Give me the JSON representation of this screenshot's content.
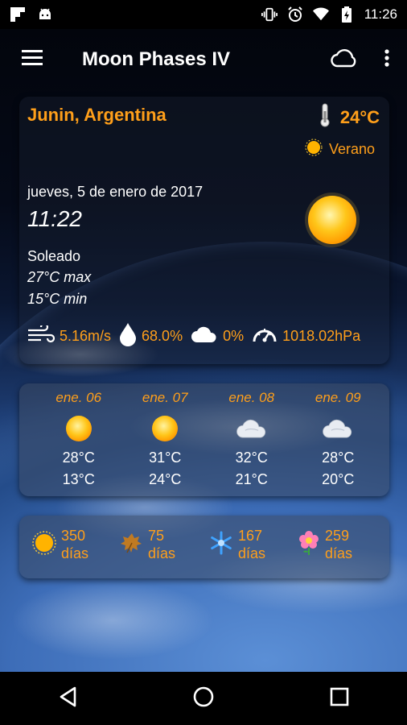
{
  "status_bar": {
    "time": "11:26",
    "left_icons": [
      "flipboard-icon",
      "android-icon"
    ],
    "right_icons": [
      "vibrate-icon",
      "alarm-icon",
      "wifi-icon",
      "battery-charging-icon"
    ]
  },
  "app_bar": {
    "title": "Moon Phases IV",
    "icons": [
      "menu-icon",
      "cloud-icon",
      "more-vert-icon"
    ]
  },
  "current": {
    "location": "Junin, Argentina",
    "temperature": "24°C",
    "season": "Verano",
    "date": "jueves, 5 de enero de 2017",
    "time": "11:22",
    "condition": "Soleado",
    "max": "27°C max",
    "min": "15°C min",
    "wind": "5.16m/s",
    "humidity": "68.0%",
    "cloud_cover": "0%",
    "pressure": "1018.02hPa"
  },
  "forecast": [
    {
      "date": "ene. 06",
      "icon": "sun-icon",
      "max": "28°C",
      "min": "13°C"
    },
    {
      "date": "ene. 07",
      "icon": "sun-icon",
      "max": "31°C",
      "min": "24°C"
    },
    {
      "date": "ene. 08",
      "icon": "cloud-icon",
      "max": "32°C",
      "min": "21°C"
    },
    {
      "date": "ene. 09",
      "icon": "cloud-icon",
      "max": "28°C",
      "min": "20°C"
    }
  ],
  "seasons": [
    {
      "icon": "summer-sun-icon",
      "count": "350",
      "unit": "días"
    },
    {
      "icon": "autumn-leaf-icon",
      "count": "75",
      "unit": "días"
    },
    {
      "icon": "winter-snowflake-icon",
      "count": "167",
      "unit": "días"
    },
    {
      "icon": "spring-flower-icon",
      "count": "259",
      "unit": "días"
    }
  ],
  "colors": {
    "accent": "#ff9f1a",
    "text": "#ffffff"
  }
}
